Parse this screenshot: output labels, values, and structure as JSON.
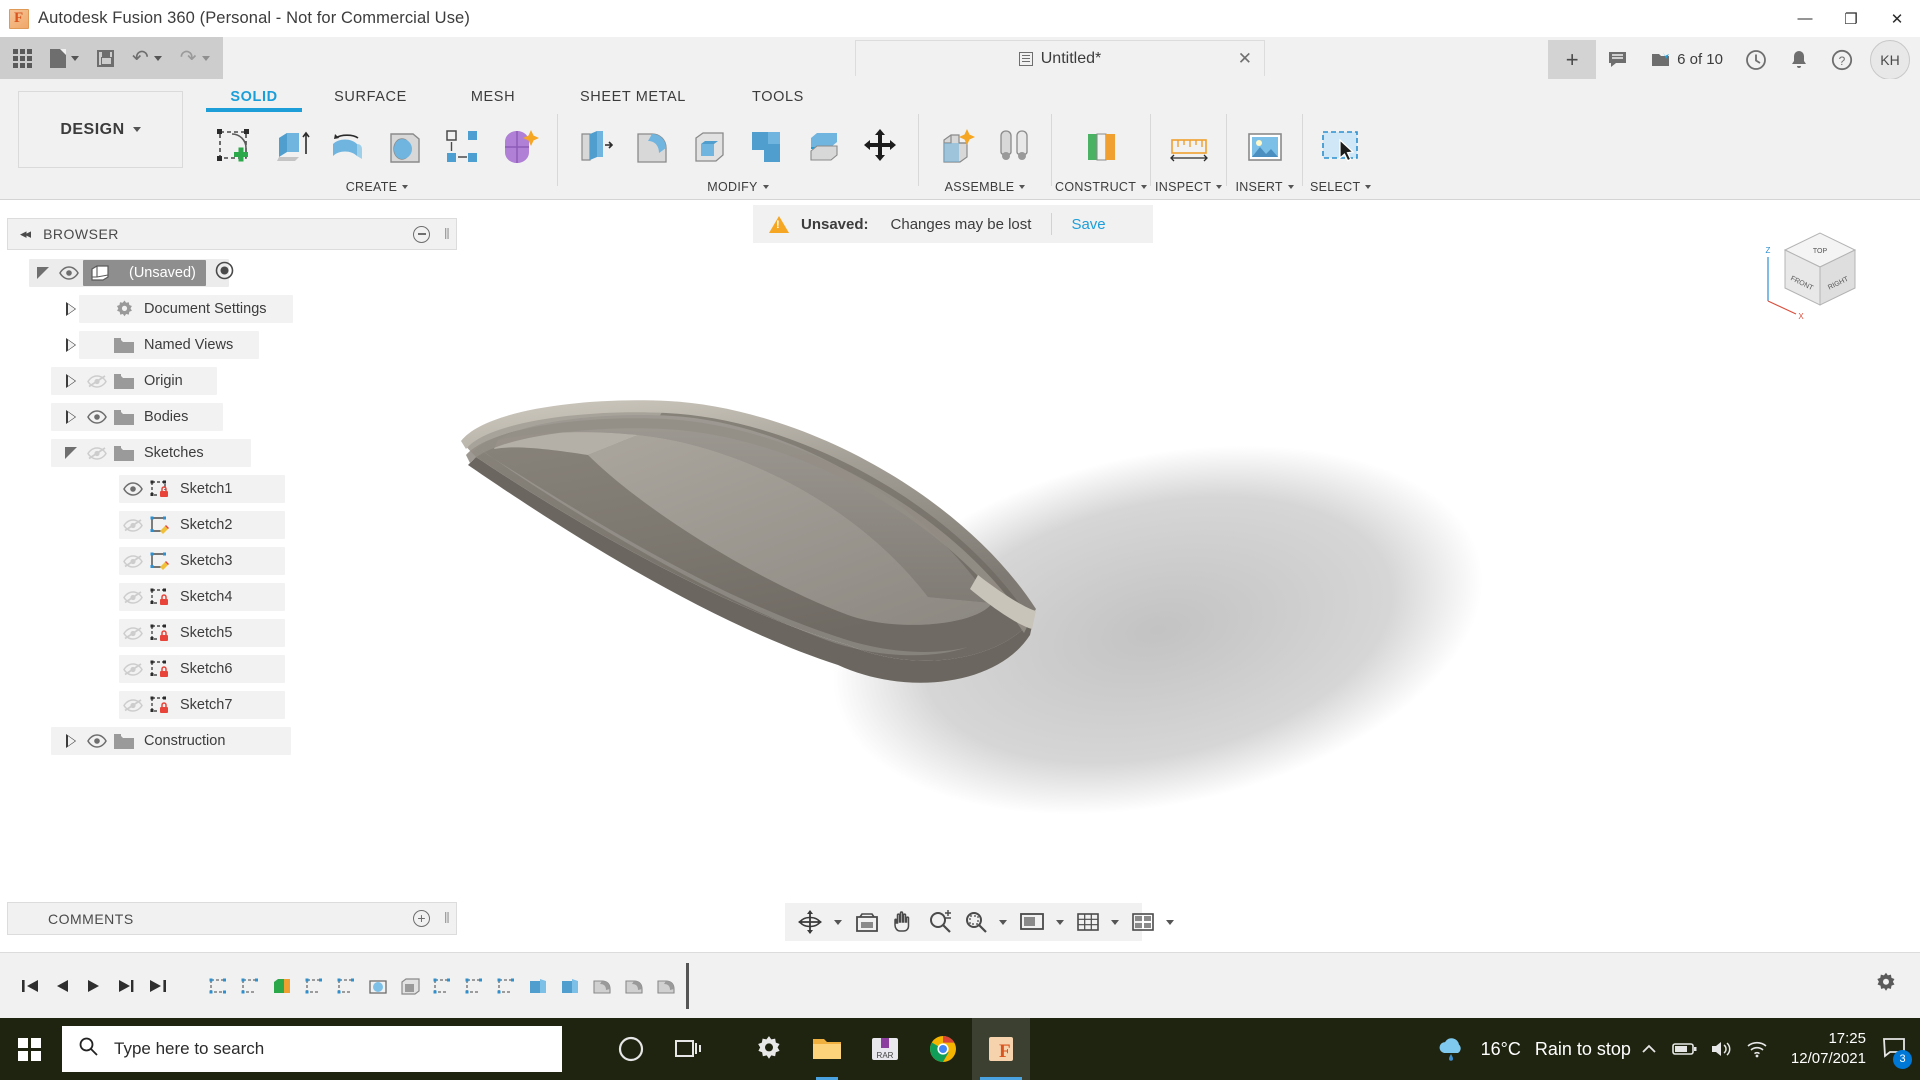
{
  "window": {
    "title": "Autodesk Fusion 360 (Personal - Not for Commercial Use)",
    "minimize": "—",
    "maximize": "❐",
    "close": "✕"
  },
  "quick_access": {
    "grid_label": "app-grid",
    "new_label": "new-document",
    "save_label": "save",
    "undo_label": "undo",
    "redo_label": "redo"
  },
  "document_tab": {
    "title": "Untitled*",
    "close": "✕",
    "new_tab": "+"
  },
  "quick_right": {
    "comment": "comment-icon",
    "jobs_text": "6 of 10",
    "history": "history-icon",
    "notifications": "bell-icon",
    "help": "?",
    "user_initials": "KH"
  },
  "workspace": {
    "label": "DESIGN",
    "caret": "▾"
  },
  "ribbon_tabs": [
    {
      "label": "SOLID",
      "active": true
    },
    {
      "label": "SURFACE",
      "active": false
    },
    {
      "label": "MESH",
      "active": false
    },
    {
      "label": "SHEET METAL",
      "active": false
    },
    {
      "label": "TOOLS",
      "active": false
    }
  ],
  "panels": [
    {
      "label": "CREATE",
      "caret": "▾",
      "tools": [
        "create-sketch-icon",
        "extrude-icon",
        "revolve-icon",
        "hole-icon",
        "pattern-icon",
        "form-icon"
      ]
    },
    {
      "label": "MODIFY",
      "caret": "▾",
      "tools": [
        "press-pull-icon",
        "fillet-icon",
        "shell-icon",
        "combine-icon",
        "offset-face-icon",
        "move-copy-icon"
      ]
    },
    {
      "label": "ASSEMBLE",
      "caret": "▾",
      "tools": [
        "new-component-icon",
        "joint-icon"
      ]
    },
    {
      "label": "CONSTRUCT",
      "caret": "▾",
      "tools": [
        "offset-plane-icon"
      ]
    },
    {
      "label": "INSPECT",
      "caret": "▾",
      "tools": [
        "measure-icon"
      ]
    },
    {
      "label": "INSERT",
      "caret": "▾",
      "tools": [
        "insert-image-icon"
      ]
    },
    {
      "label": "SELECT",
      "caret": "▾",
      "tools": [
        "select-icon"
      ]
    }
  ],
  "browser": {
    "title": "BROWSER",
    "collapse": "◂◂",
    "minus": "minus-icon",
    "tree": [
      {
        "label": "(Unsaved)",
        "indent": 0,
        "expander": "open",
        "eye": "visible",
        "icon": "component-icon",
        "selected": true,
        "radio": true
      },
      {
        "label": "Document Settings",
        "indent": 1,
        "expander": "closed",
        "eye": "none",
        "icon": "gear-icon",
        "selected": false,
        "radio": false
      },
      {
        "label": "Named Views",
        "indent": 1,
        "expander": "closed",
        "eye": "none",
        "icon": "folder-icon",
        "selected": false,
        "radio": false
      },
      {
        "label": "Origin",
        "indent": 1,
        "expander": "closed",
        "eye": "hidden",
        "icon": "folder-icon",
        "selected": false,
        "radio": false
      },
      {
        "label": "Bodies",
        "indent": 1,
        "expander": "closed",
        "eye": "visible",
        "icon": "folder-icon",
        "selected": false,
        "radio": false
      },
      {
        "label": "Sketches",
        "indent": 1,
        "expander": "open",
        "eye": "hidden",
        "icon": "folder-icon",
        "selected": false,
        "radio": false
      },
      {
        "label": "Sketch1",
        "indent": 2,
        "expander": "none",
        "eye": "visible",
        "icon": "sketch-lock-icon",
        "selected": false,
        "radio": false
      },
      {
        "label": "Sketch2",
        "indent": 2,
        "expander": "none",
        "eye": "hidden",
        "icon": "sketch-edit-icon",
        "selected": false,
        "radio": false
      },
      {
        "label": "Sketch3",
        "indent": 2,
        "expander": "none",
        "eye": "hidden",
        "icon": "sketch-edit-icon",
        "selected": false,
        "radio": false
      },
      {
        "label": "Sketch4",
        "indent": 2,
        "expander": "none",
        "eye": "hidden",
        "icon": "sketch-lock-icon",
        "selected": false,
        "radio": false
      },
      {
        "label": "Sketch5",
        "indent": 2,
        "expander": "none",
        "eye": "hidden",
        "icon": "sketch-lock-icon",
        "selected": false,
        "radio": false
      },
      {
        "label": "Sketch6",
        "indent": 2,
        "expander": "none",
        "eye": "hidden",
        "icon": "sketch-lock-icon",
        "selected": false,
        "radio": false
      },
      {
        "label": "Sketch7",
        "indent": 2,
        "expander": "none",
        "eye": "hidden",
        "icon": "sketch-lock-icon",
        "selected": false,
        "radio": false
      },
      {
        "label": "Construction",
        "indent": 1,
        "expander": "closed",
        "eye": "visible",
        "icon": "folder-icon",
        "selected": false,
        "radio": false
      }
    ]
  },
  "unsaved_bar": {
    "warning_icon": "warning-triangle-icon",
    "status": "Unsaved:",
    "message": "Changes may be lost",
    "action": "Save"
  },
  "viewcube": {
    "top": "TOP",
    "front": "FRONT",
    "right": "RIGHT",
    "axis_z": "Z",
    "axis_x": "X"
  },
  "navbar": {
    "buttons": [
      "orbit-icon",
      "orbit-caret",
      "look-at-icon",
      "pan-icon",
      "zoom-icon",
      "zoom-window-icon",
      "zoom-window-caret",
      "display-settings-icon",
      "display-settings-caret",
      "grid-snaps-icon",
      "grid-snaps-caret",
      "viewports-icon",
      "viewports-caret"
    ]
  },
  "comments": {
    "label": "COMMENTS",
    "plus": "plus-icon"
  },
  "timeline": {
    "playback": [
      "skip-start-icon",
      "step-back-icon",
      "play-icon",
      "step-forward-icon",
      "skip-end-icon"
    ],
    "features": [
      "sketch-feature-icon",
      "sketch-feature-icon",
      "extrude-feature-icon",
      "sketch-feature-icon",
      "sketch-feature-icon",
      "loft-feature-icon",
      "shell-feature-icon",
      "sketch-feature-icon",
      "sketch-feature-icon",
      "sketch-feature-icon",
      "extrude-feature-icon",
      "extrude-feature-icon",
      "fillet-feature-icon",
      "fillet-feature-icon",
      "fillet-feature-icon"
    ],
    "settings": "gear-icon"
  },
  "taskbar": {
    "start": "windows-start-icon",
    "search_placeholder": "Type here to search",
    "cortana": "cortana-icon",
    "task_view": "task-view-icon",
    "apps": [
      "settings-icon",
      "file-explorer-icon",
      "winrar-icon",
      "chrome-icon",
      "fusion360-icon"
    ],
    "weather_temp": "16°C",
    "weather_desc": "Rain to stop",
    "tray": [
      "chevron-up-icon",
      "battery-icon",
      "volume-icon",
      "network-icon"
    ],
    "time": "17:25",
    "date": "12/07/2021",
    "notification_count": "3"
  },
  "colors": {
    "accent": "#1d9ed9",
    "warning": "#f5a623",
    "ribbon_bg": "#f1f1f1",
    "taskbar_bg": "#1f2410"
  }
}
